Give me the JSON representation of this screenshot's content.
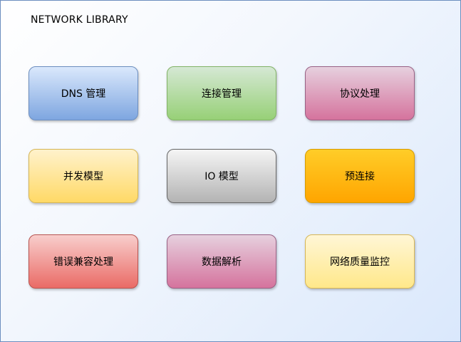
{
  "title": "NETWORK  LIBRARY",
  "modules": {
    "dns": {
      "label": "DNS 管理",
      "color": "#7ea6e0"
    },
    "connection": {
      "label": "连接管理",
      "color": "#97d077"
    },
    "protocol": {
      "label": "协议处理",
      "color": "#d5739d"
    },
    "concurrency": {
      "label": "并发模型",
      "color": "#ffd966"
    },
    "io": {
      "label": "IO 模型",
      "color": "#b3b3b3"
    },
    "preconnect": {
      "label": "预连接",
      "color": "#ffa500"
    },
    "error": {
      "label": "错误兼容处理",
      "color": "#ea6b66"
    },
    "parsing": {
      "label": "数据解析",
      "color": "#d5739d"
    },
    "monitoring": {
      "label": "网络质量监控",
      "color": "#ffe88a"
    }
  }
}
